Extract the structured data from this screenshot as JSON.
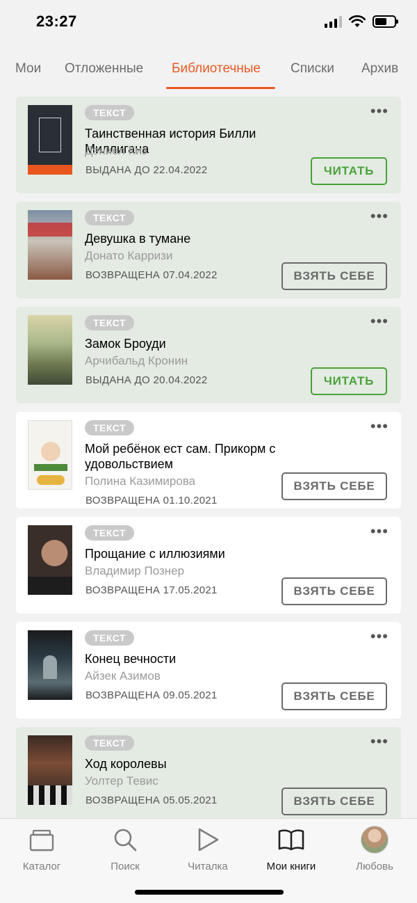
{
  "status_bar": {
    "time": "23:27"
  },
  "tabs": [
    {
      "label": "Мои",
      "active": false
    },
    {
      "label": "Отложенные",
      "active": false
    },
    {
      "label": "Библиотечные",
      "active": true
    },
    {
      "label": "Списки",
      "active": false
    },
    {
      "label": "Архив",
      "active": false
    }
  ],
  "books": [
    {
      "badge": "ТЕКСТ",
      "title": "Таинственная история Билли Миллигана",
      "author": "Дэниел Киз",
      "status": "ВЫДАНА ДО 22.04.2022",
      "action": "ЧИТАТЬ",
      "highlighted": true
    },
    {
      "badge": "ТЕКСТ",
      "title": "Девушка в тумане",
      "author": "Донато Карризи",
      "status": "ВОЗВРАЩЕНА 07.04.2022",
      "action": "ВЗЯТЬ СЕБЕ",
      "highlighted": true
    },
    {
      "badge": "ТЕКСТ",
      "title": "Замок Броуди",
      "author": "Арчибальд Кронин",
      "status": "ВЫДАНА ДО 20.04.2022",
      "action": "ЧИТАТЬ",
      "highlighted": true
    },
    {
      "badge": "ТЕКСТ",
      "title": "Мой ребёнок ест сам. Прикорм с удовольствием",
      "author": "Полина Казимирова",
      "status": "ВОЗВРАЩЕНА 01.10.2021",
      "action": "ВЗЯТЬ СЕБЕ",
      "highlighted": false
    },
    {
      "badge": "ТЕКСТ",
      "title": "Прощание с иллюзиями",
      "author": "Владимир Познер",
      "status": "ВОЗВРАЩЕНА 17.05.2021",
      "action": "ВЗЯТЬ СЕБЕ",
      "highlighted": false
    },
    {
      "badge": "ТЕКСТ",
      "title": "Конец вечности",
      "author": "Айзек Азимов",
      "status": "ВОЗВРАЩЕНА 09.05.2021",
      "action": "ВЗЯТЬ СЕБЕ",
      "highlighted": false
    },
    {
      "badge": "ТЕКСТ",
      "title": "Ход королевы",
      "author": "Уолтер Тевис",
      "status": "ВОЗВРАЩЕНА 05.05.2021",
      "action": "ВЗЯТЬ СЕБЕ",
      "highlighted": true
    }
  ],
  "bottom_nav": [
    {
      "label": "Каталог",
      "icon": "catalog-icon",
      "active": false
    },
    {
      "label": "Поиск",
      "icon": "search-icon",
      "active": false
    },
    {
      "label": "Читалка",
      "icon": "play-icon",
      "active": false
    },
    {
      "label": "Мои книги",
      "icon": "book-icon",
      "active": true
    },
    {
      "label": "Любовь",
      "icon": "avatar",
      "active": false
    }
  ],
  "colors": {
    "accent": "#ea5a26",
    "read_button": "#4aa13a",
    "highlight_card": "#e3ebe2"
  }
}
